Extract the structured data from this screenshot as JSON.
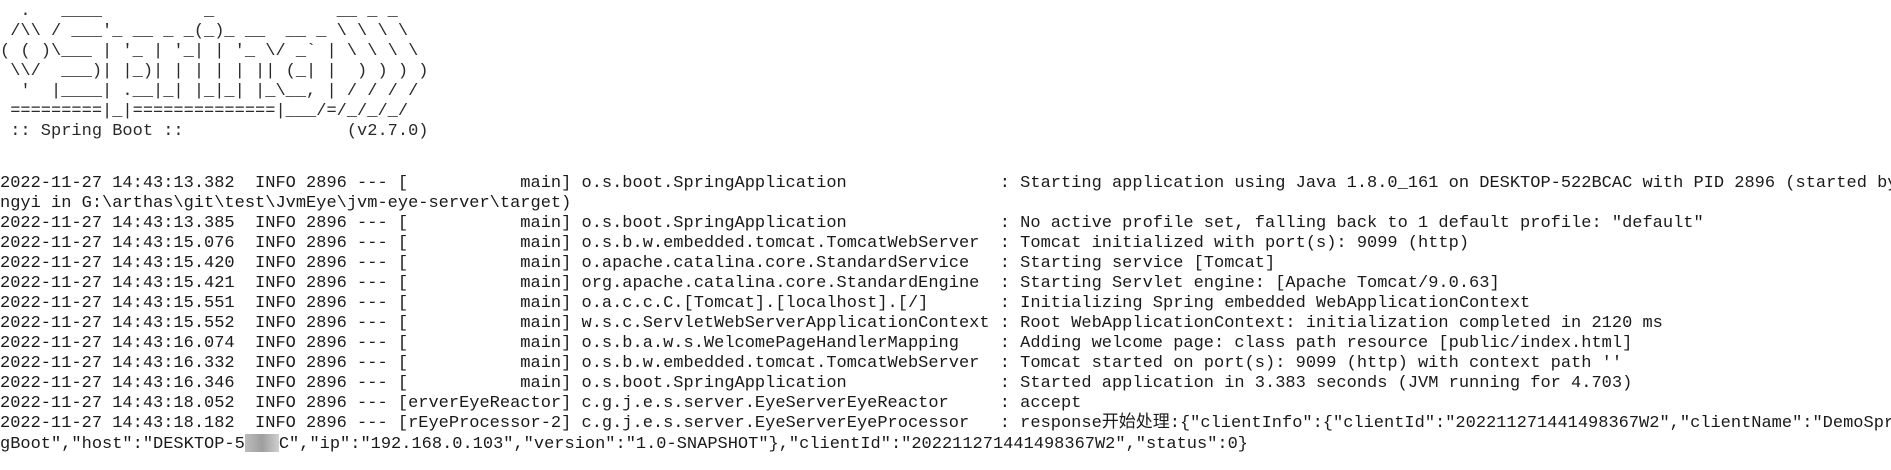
{
  "banner": {
    "art": "  .   ____          _            __ _ _\n /\\\\ / ___'_ __ _ _(_)_ __  __ _ \\ \\ \\ \\\n( ( )\\___ | '_ | '_| | '_ \\/ _` | \\ \\ \\ \\\n \\\\/  ___)| |_)| | | | | || (_| |  ) ) ) )\n  '  |____| .__|_| |_|_| |_\\__, | / / / /\n =========|_|==============|___/=/_/_/_/",
    "version_line": " :: Spring Boot ::                (v2.7.0)"
  },
  "log_lines": [
    "2022-11-27 14:43:13.382  INFO 2896 --- [           main] o.s.boot.SpringApplication               : Starting application using Java 1.8.0_161 on DESKTOP-522BCAC with PID 2896 (started by go",
    "ngyi in G:\\arthas\\git\\test\\JvmEye\\jvm-eye-server\\target)",
    "2022-11-27 14:43:13.385  INFO 2896 --- [           main] o.s.boot.SpringApplication               : No active profile set, falling back to 1 default profile: \"default\"",
    "2022-11-27 14:43:15.076  INFO 2896 --- [           main] o.s.b.w.embedded.tomcat.TomcatWebServer  : Tomcat initialized with port(s): 9099 (http)",
    "2022-11-27 14:43:15.420  INFO 2896 --- [           main] o.apache.catalina.core.StandardService   : Starting service [Tomcat]",
    "2022-11-27 14:43:15.421  INFO 2896 --- [           main] org.apache.catalina.core.StandardEngine  : Starting Servlet engine: [Apache Tomcat/9.0.63]",
    "2022-11-27 14:43:15.551  INFO 2896 --- [           main] o.a.c.c.C.[Tomcat].[localhost].[/]       : Initializing Spring embedded WebApplicationContext",
    "2022-11-27 14:43:15.552  INFO 2896 --- [           main] w.s.c.ServletWebServerApplicationContext : Root WebApplicationContext: initialization completed in 2120 ms",
    "2022-11-27 14:43:16.074  INFO 2896 --- [           main] o.s.b.a.w.s.WelcomePageHandlerMapping    : Adding welcome page: class path resource [public/index.html]",
    "2022-11-27 14:43:16.332  INFO 2896 --- [           main] o.s.b.w.embedded.tomcat.TomcatWebServer  : Tomcat started on port(s): 9099 (http) with context path ''",
    "2022-11-27 14:43:16.346  INFO 2896 --- [           main] o.s.boot.SpringApplication               : Started application in 3.383 seconds (JVM running for 4.703)",
    "2022-11-27 14:43:18.052  INFO 2896 --- [erverEyeReactor] c.g.j.e.s.server.EyeServerEyeReactor     : accept",
    "2022-11-27 14:43:18.182  INFO 2896 --- [rEyeProcessor-2] c.g.j.e.s.server.EyeServerEyeProcessor   : response开始处理:{\"clientInfo\":{\"clientId\":\"202211271441498367W2\",\"clientName\":\"DemoSprin"
  ],
  "last_line": {
    "before_redaction": "gBoot\",\"host\":\"DESKTOP-5",
    "after_redaction": "C\",\"ip\":\"192.168.0.103\",\"version\":\"1.0-SNAPSHOT\"},\"clientId\":\"202211271441498367W2\",\"status\":0}"
  }
}
